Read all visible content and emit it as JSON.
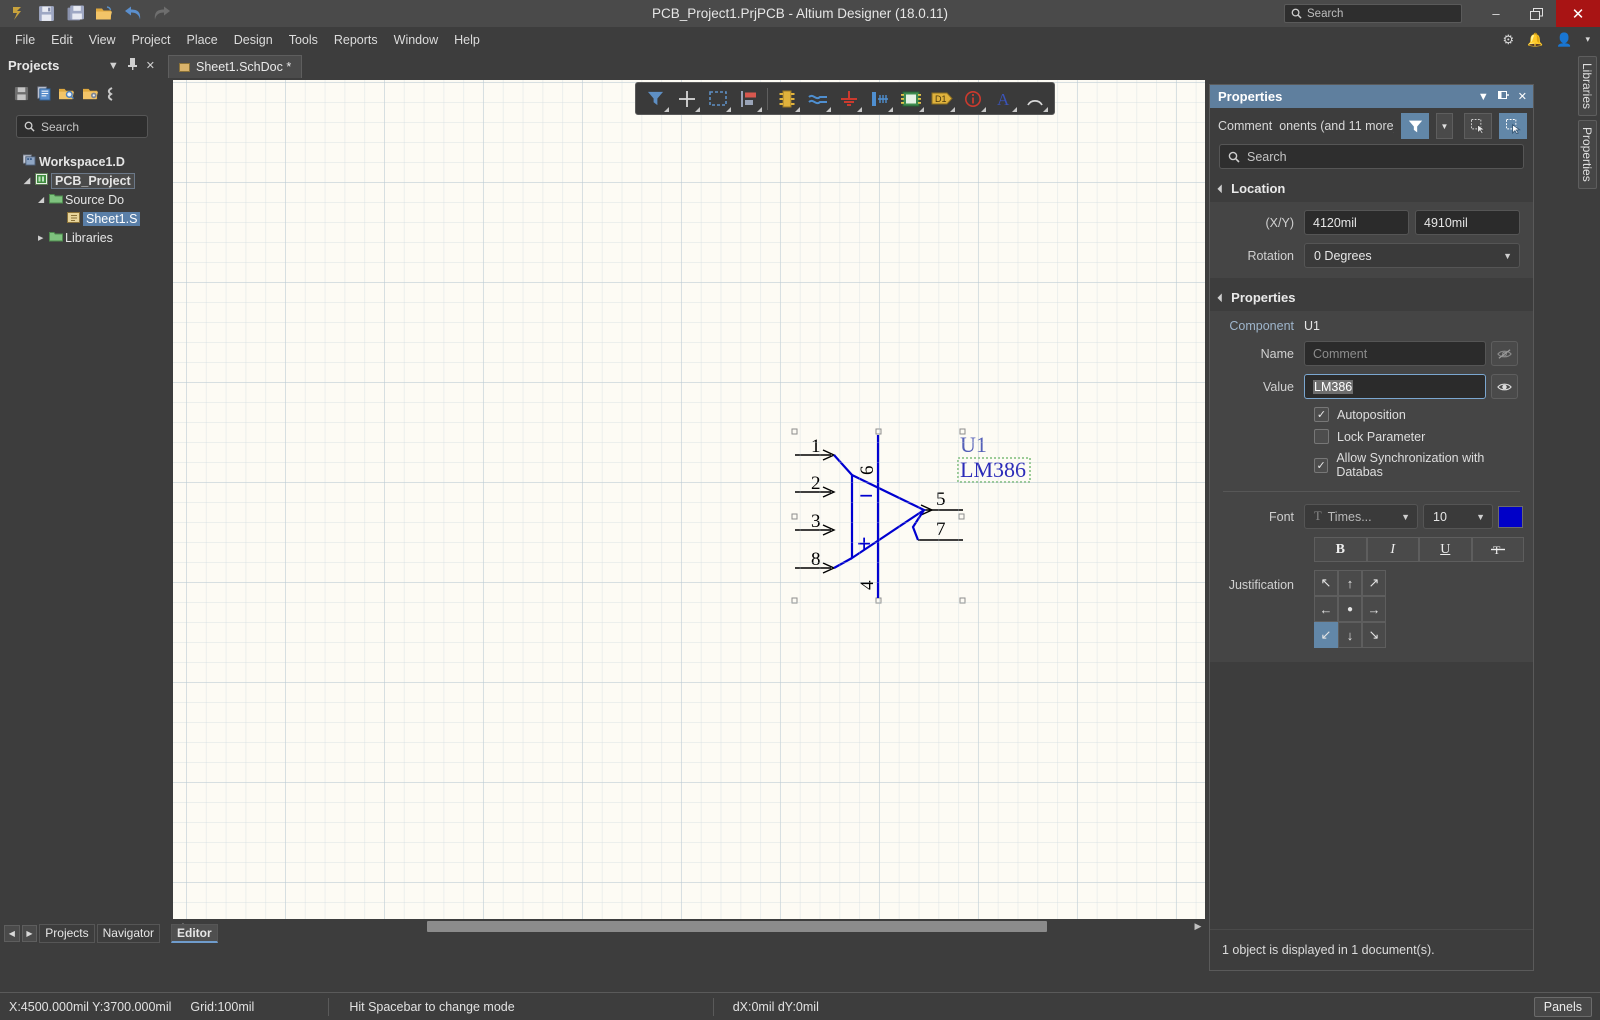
{
  "window": {
    "title": "PCB_Project1.PrjPCB - Altium Designer (18.0.11)",
    "search_placeholder": "Search",
    "minimize": "–",
    "restore": "❐",
    "close": "✕"
  },
  "quick_access": [
    {
      "name": "altium-logo-icon",
      "glyph": "ɘ"
    },
    {
      "name": "save-icon",
      "glyph": "💾"
    },
    {
      "name": "save-all-icon",
      "glyph": "💾"
    },
    {
      "name": "open-folder-icon",
      "glyph": "📂"
    },
    {
      "name": "undo-icon",
      "glyph": "↶"
    },
    {
      "name": "redo-icon",
      "glyph": "↷"
    }
  ],
  "menu": [
    {
      "label": "File",
      "accel": "F"
    },
    {
      "label": "Edit",
      "accel": "E"
    },
    {
      "label": "View",
      "accel": "V"
    },
    {
      "label": "Project",
      "accel": "j"
    },
    {
      "label": "Place",
      "accel": "P"
    },
    {
      "label": "Design",
      "accel": "D"
    },
    {
      "label": "Tools",
      "accel": "T"
    },
    {
      "label": "Reports",
      "accel": "R"
    },
    {
      "label": "Window",
      "accel": "W"
    },
    {
      "label": "Help",
      "accel": "H"
    }
  ],
  "menu_right_icons": [
    {
      "name": "settings-gear-icon",
      "glyph": "⚙"
    },
    {
      "name": "notifications-bell-icon",
      "glyph": "🔔"
    },
    {
      "name": "user-account-icon",
      "glyph": "👤"
    },
    {
      "name": "chevron-down-icon",
      "glyph": "▾"
    }
  ],
  "projects_panel": {
    "title": "Projects",
    "header_buttons": [
      {
        "name": "panel-dropdown-icon",
        "glyph": "▼"
      },
      {
        "name": "pin-icon",
        "glyph": "📌"
      },
      {
        "name": "close-icon",
        "glyph": "✕"
      }
    ],
    "toolbar": [
      {
        "name": "save-project-icon",
        "glyph": "💾"
      },
      {
        "name": "compile-document-icon",
        "glyph": "📄"
      },
      {
        "name": "open-project-search-icon",
        "glyph": "📁"
      },
      {
        "name": "project-options-icon",
        "glyph": "📁"
      },
      {
        "name": "more-options-icon",
        "glyph": "‹"
      }
    ],
    "search_placeholder": "Search",
    "tree": [
      {
        "label": "Workspace1.D",
        "indent": 0,
        "icon": "workspace-icon",
        "bold": true,
        "twisty": "",
        "style": "plain"
      },
      {
        "label": "PCB_Project",
        "indent": 1,
        "icon": "pcb-project-icon",
        "bold": true,
        "twisty": "◢",
        "style": "boxed"
      },
      {
        "label": "Source Do",
        "indent": 2,
        "icon": "folder-icon",
        "bold": false,
        "twisty": "◢",
        "style": "plain"
      },
      {
        "label": "Sheet1.S",
        "indent": 3,
        "icon": "schdoc-icon",
        "bold": false,
        "twisty": "",
        "style": "selected"
      },
      {
        "label": "Libraries",
        "indent": 2,
        "icon": "folder-icon",
        "bold": false,
        "twisty": "▶",
        "style": "plain"
      }
    ],
    "bottom_tabs": [
      "Projects",
      "Navigator"
    ]
  },
  "editor": {
    "document_tab": "Sheet1.SchDoc *",
    "bottom_tab": "Editor",
    "toolbar": [
      {
        "name": "filter-icon",
        "glyph": "filter"
      },
      {
        "name": "crosshair-cursor-icon",
        "glyph": "cross"
      },
      {
        "name": "select-area-icon",
        "glyph": "marquee"
      },
      {
        "name": "align-objects-icon",
        "glyph": "align"
      },
      {
        "name": "place-part-icon",
        "glyph": "chip"
      },
      {
        "name": "place-wire-icon",
        "glyph": "wire"
      },
      {
        "name": "place-gnd-power-port-icon",
        "glyph": "gnd"
      },
      {
        "name": "place-net-label-icon",
        "glyph": "netlabel"
      },
      {
        "name": "place-sheet-symbol-icon",
        "glyph": "sheet"
      },
      {
        "name": "place-port-icon",
        "glyph": "port"
      },
      {
        "name": "place-no-erc-icon",
        "glyph": "noerc"
      },
      {
        "name": "place-text-string-icon",
        "glyph": "textA"
      },
      {
        "name": "place-arc-icon",
        "glyph": "arc"
      }
    ]
  },
  "schematic": {
    "designator": "U1",
    "value": "LM386",
    "pins": [
      "1",
      "2",
      "3",
      "4",
      "5",
      "6",
      "7",
      "8"
    ],
    "inverting_label": "−",
    "noninverting_label": "+"
  },
  "properties_panel": {
    "title": "Properties",
    "header_buttons": [
      {
        "name": "panel-dropdown-icon",
        "glyph": "▼"
      },
      {
        "name": "pin-icon",
        "glyph": "❑"
      },
      {
        "name": "close-icon",
        "glyph": "✕"
      }
    ],
    "object_type_label": "Comment",
    "object_count_label": "onents (and 11 more)",
    "toolbar_buttons": [
      {
        "name": "filter-button",
        "glyph": "▼"
      },
      {
        "name": "filter-dropdown-button",
        "glyph": "▾"
      },
      {
        "name": "select-all-button",
        "glyph": "❐"
      },
      {
        "name": "zoom-to-selection-button",
        "glyph": "❐"
      }
    ],
    "search_placeholder": "Search",
    "location": {
      "section_title": "Location",
      "xy_label": "(X/Y)",
      "x_value": "4120mil",
      "y_value": "4910mil",
      "rotation_label": "Rotation",
      "rotation_value": "0 Degrees"
    },
    "properties": {
      "section_title": "Properties",
      "component_label": "Component",
      "component_value": "U1",
      "name_label": "Name",
      "name_placeholder": "Comment",
      "name_visibility_icon": "eye-hidden-icon",
      "value_label": "Value",
      "value_text": "LM386",
      "value_visibility_icon": "eye-visible-icon",
      "checkboxes": [
        {
          "label": "Autoposition",
          "checked": true
        },
        {
          "label": "Lock Parameter",
          "checked": false
        },
        {
          "label": "Allow Synchronization with Databas",
          "checked": true
        }
      ],
      "font_label": "Font",
      "font_family": "Times...",
      "font_size": "10",
      "font_color": "#0000c8",
      "style_buttons": [
        {
          "name": "bold-button",
          "label": "B"
        },
        {
          "name": "italic-button",
          "label": "I"
        },
        {
          "name": "underline-button",
          "label": "U"
        },
        {
          "name": "strikethrough-button",
          "label": "ᴛ"
        }
      ],
      "justification_label": "Justification",
      "justification_cells": [
        {
          "name": "justify-top-left",
          "glyph": "↖",
          "selected": false
        },
        {
          "name": "justify-top-center",
          "glyph": "↑",
          "selected": false
        },
        {
          "name": "justify-top-right",
          "glyph": "↗",
          "selected": false
        },
        {
          "name": "justify-middle-left",
          "glyph": "←",
          "selected": false
        },
        {
          "name": "justify-middle-center",
          "glyph": "●",
          "selected": false
        },
        {
          "name": "justify-middle-right",
          "glyph": "→",
          "selected": false
        },
        {
          "name": "justify-bottom-left",
          "glyph": "↙",
          "selected": true
        },
        {
          "name": "justify-bottom-center",
          "glyph": "↓",
          "selected": false
        },
        {
          "name": "justify-bottom-right",
          "glyph": "↘",
          "selected": false
        }
      ]
    },
    "footer": "1 object is displayed in 1 document(s)."
  },
  "vertical_tabs": [
    "Libraries",
    "Properties"
  ],
  "status_bar": {
    "coordinates": "X:4500.000mil Y:3700.000mil",
    "grid": "Grid:100mil",
    "hint": "Hit Spacebar to change mode",
    "delta": "dX:0mil dY:0mil",
    "panels_button": "Panels"
  },
  "colors": {
    "accent_blue": "#5f7f9e",
    "selection_blue": "#6287a8",
    "schematic_blue": "#0000d0",
    "canvas": "#fdfbf4",
    "chrome": "#3d3d3d"
  }
}
